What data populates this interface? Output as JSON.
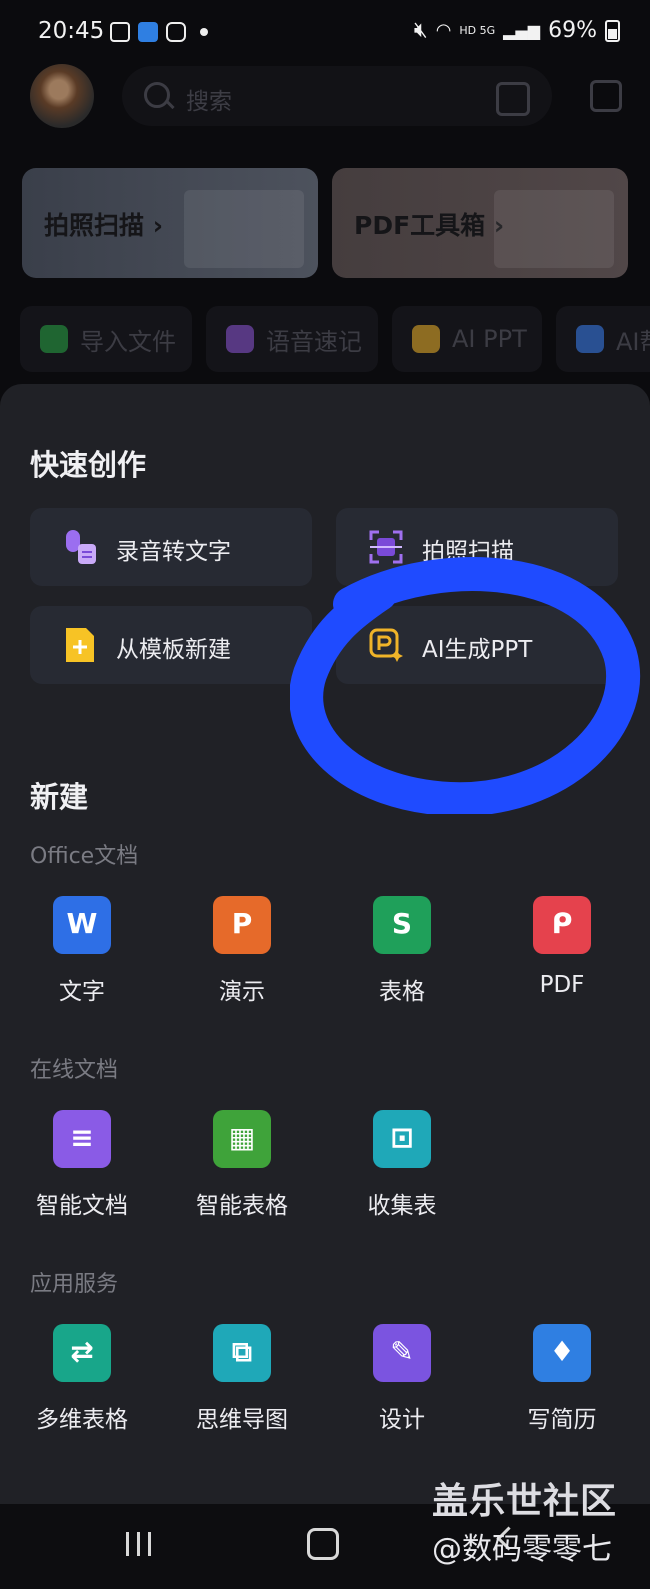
{
  "status": {
    "time": "20:45",
    "battery": "69%",
    "net": "HD 5G"
  },
  "search": {
    "placeholder": "搜索"
  },
  "cards": [
    {
      "label": "拍照扫描 ›"
    },
    {
      "label": "PDF工具箱 ›"
    }
  ],
  "chips": [
    {
      "label": "导入文件",
      "color": "#28a745"
    },
    {
      "label": "语音速记",
      "color": "#8e55d9"
    },
    {
      "label": "AI PPT",
      "color": "#f0b429"
    },
    {
      "label": "AI帮",
      "color": "#3b82f6"
    }
  ],
  "quick": {
    "title": "快速创作",
    "items": [
      {
        "label": "录音转文字"
      },
      {
        "label": "拍照扫描"
      },
      {
        "label": "从模板新建"
      },
      {
        "label": "AI生成PPT"
      }
    ]
  },
  "new": {
    "title": "新建",
    "office": {
      "title": "Office文档",
      "items": [
        {
          "label": "文字",
          "glyph": "W",
          "color": "#2e6fe6"
        },
        {
          "label": "演示",
          "glyph": "P",
          "color": "#e66a2a"
        },
        {
          "label": "表格",
          "glyph": "S",
          "color": "#1fa05a"
        },
        {
          "label": "PDF",
          "glyph": "ᑭ",
          "color": "#e5424d"
        }
      ]
    },
    "online": {
      "title": "在线文档",
      "items": [
        {
          "label": "智能文档",
          "glyph": "≡",
          "color": "#8a5be6"
        },
        {
          "label": "智能表格",
          "glyph": "▦",
          "color": "#3fa33a"
        },
        {
          "label": "收集表",
          "glyph": "⊡",
          "color": "#1fa8b8"
        }
      ]
    },
    "apps": {
      "title": "应用服务",
      "items": [
        {
          "label": "多维表格",
          "glyph": "⇄",
          "color": "#18a68a"
        },
        {
          "label": "思维导图",
          "glyph": "⧉",
          "color": "#1fa8b8"
        },
        {
          "label": "设计",
          "glyph": "✎",
          "color": "#7b54e0"
        },
        {
          "label": "写简历",
          "glyph": "♦",
          "color": "#2f7fe2"
        }
      ]
    }
  },
  "watermark": {
    "line1": "盖乐世社区",
    "line2": "@数码零零七"
  }
}
